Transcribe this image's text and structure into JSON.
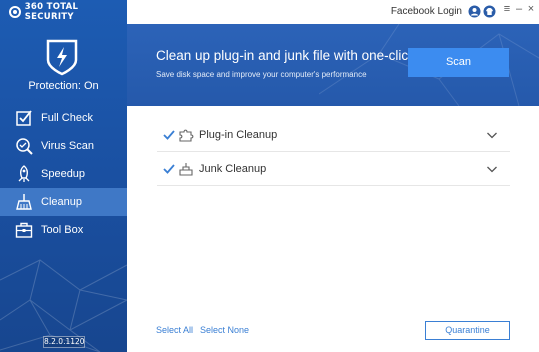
{
  "app": {
    "brand": "360 TOTAL SECURITY",
    "version": "8.2.0.1120"
  },
  "titlebar": {
    "login_label": "Facebook Login",
    "icons": [
      "avatar-icon",
      "shirt-icon",
      "menu-icon",
      "minimize-icon",
      "close-icon"
    ]
  },
  "sidebar": {
    "protection_status": "Protection: On",
    "items": [
      {
        "label": "Full Check",
        "icon": "checkbox-icon",
        "active": false
      },
      {
        "label": "Virus Scan",
        "icon": "virus-scan-icon",
        "active": false
      },
      {
        "label": "Speedup",
        "icon": "rocket-icon",
        "active": false
      },
      {
        "label": "Cleanup",
        "icon": "broom-icon",
        "active": true
      },
      {
        "label": "Tool Box",
        "icon": "toolbox-icon",
        "active": false
      }
    ]
  },
  "banner": {
    "title": "Clean up plug-in and junk file with one-click",
    "subtitle": "Save disk space and improve your computer's performance",
    "scan_label": "Scan"
  },
  "list": {
    "items": [
      {
        "label": "Plug-in Cleanup",
        "icon": "puzzle-icon",
        "checked": true
      },
      {
        "label": "Junk Cleanup",
        "icon": "junk-icon",
        "checked": true
      }
    ]
  },
  "footer": {
    "select_all": "Select All",
    "select_none": "Select None",
    "quarantine": "Quarantine"
  },
  "colors": {
    "sidebar": "#1d5cb3",
    "active_item": "#3f78c6",
    "banner": "#2c63b8",
    "scan_button": "#3c8cf0",
    "link": "#3a7fd4"
  }
}
